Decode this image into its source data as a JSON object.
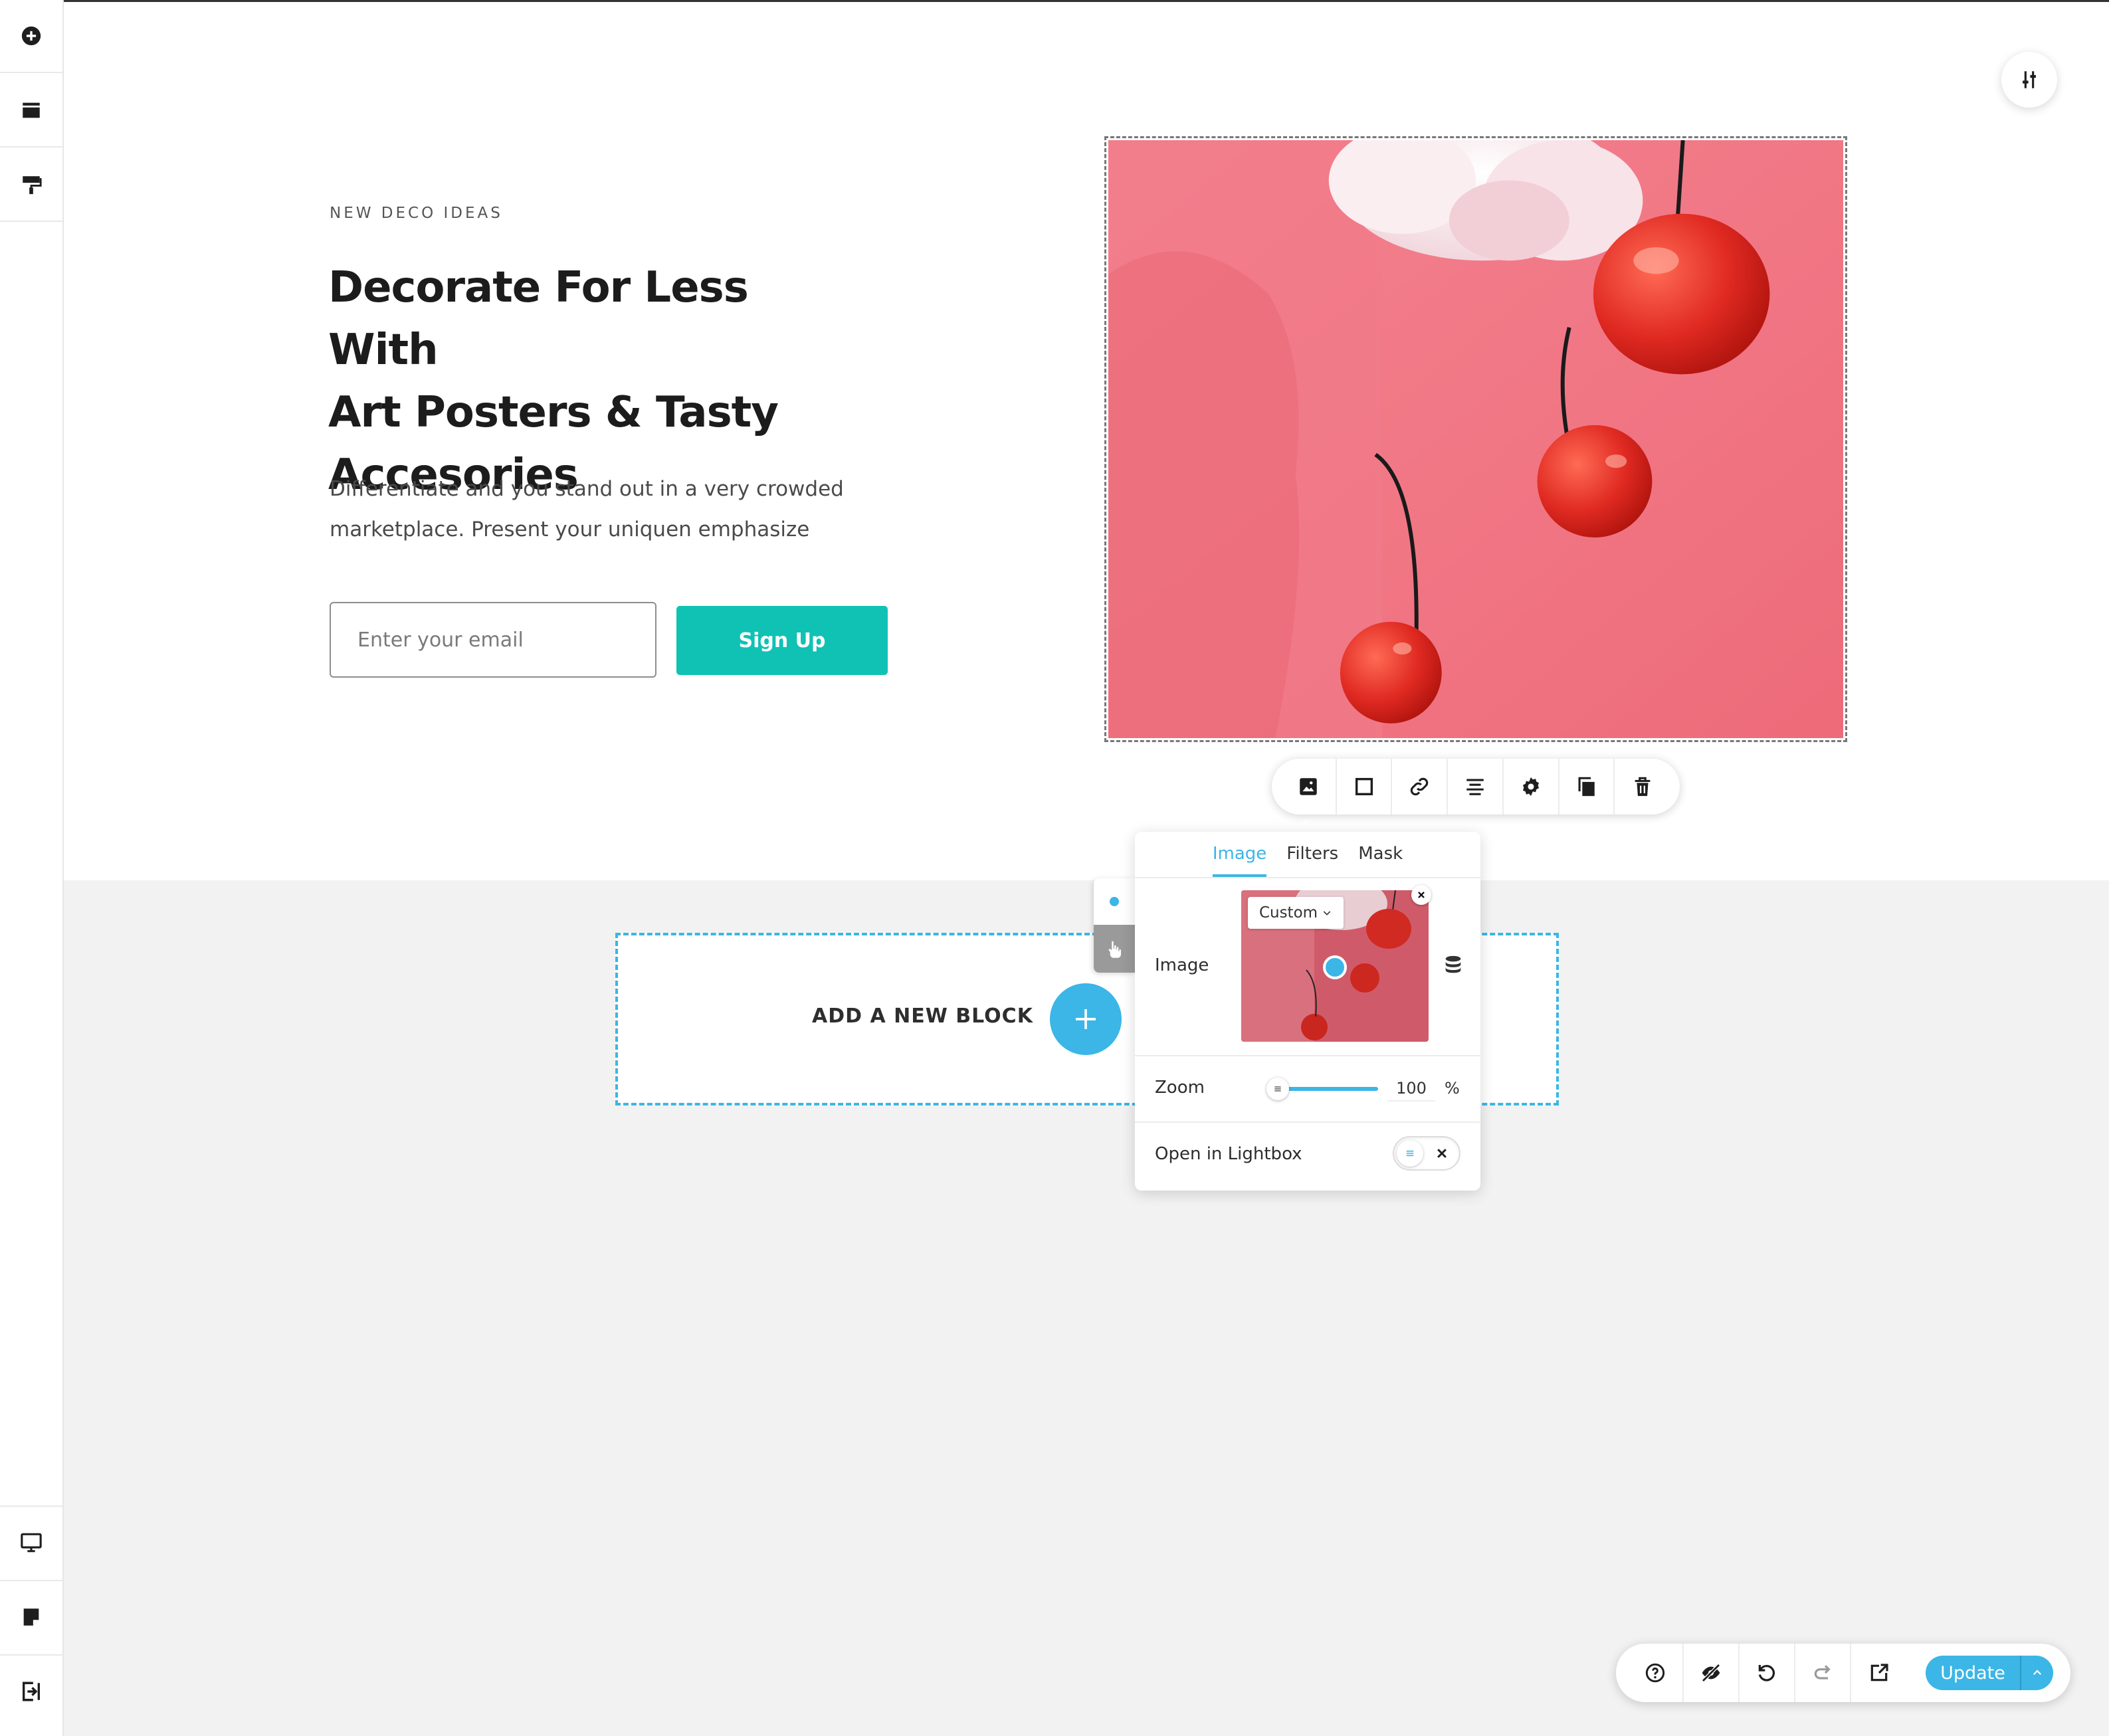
{
  "sidebar": {
    "top": [
      "add-icon",
      "layout-icon",
      "paint-roller-icon"
    ],
    "bottom": [
      "desktop-icon",
      "page-icon",
      "exit-icon"
    ]
  },
  "hero": {
    "eyebrow": "NEW DECO IDEAS",
    "headline_lines": [
      "Decorate For Less With",
      "Art Posters & Tasty",
      "Accesories"
    ],
    "paragraph_lines": [
      "Differentiate and you stand out in a very crowded",
      "marketplace. Present your uniquen emphasize"
    ],
    "email_placeholder": "Enter your email",
    "signup_label": "Sign Up"
  },
  "image_toolbar": [
    "image-icon",
    "border-icon",
    "link-icon",
    "align-center-icon",
    "gear-icon",
    "duplicate-icon",
    "trash-icon"
  ],
  "add_block": {
    "label": "ADD A NEW BLOCK"
  },
  "popover": {
    "tabs": [
      "Image",
      "Filters",
      "Mask"
    ],
    "active_tab": "Image",
    "image_label": "Image",
    "size_select": "Custom",
    "zoom_label": "Zoom",
    "zoom_value": "100",
    "zoom_unit": "%",
    "lightbox_label": "Open in Lightbox",
    "lightbox_on": false
  },
  "bottom_bar": {
    "icons": [
      "help-icon",
      "hide-icon",
      "undo-icon",
      "redo-icon",
      "external-link-icon"
    ],
    "update_label": "Update"
  },
  "colors": {
    "accent": "#3bb6e6",
    "signup": "#0fc2b4",
    "hero_bg": "#f07180",
    "cherry": "#e12c24"
  }
}
